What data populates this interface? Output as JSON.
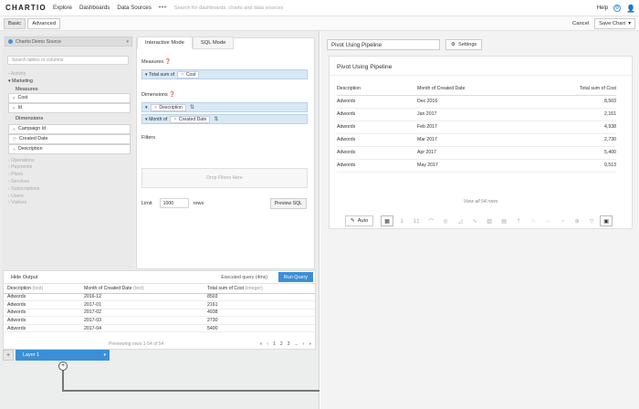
{
  "topbar": {
    "logo": "CHARTIO",
    "nav": [
      "Explore",
      "Dashboards",
      "Data Sources"
    ],
    "more": "•••",
    "search_placeholder": "Search for dashboards, charts and data sources",
    "help": "Help"
  },
  "subbar": {
    "tabs": [
      "Basic",
      "Advanced"
    ],
    "cancel": "Cancel",
    "save_chart": "Save Chart"
  },
  "schema": {
    "data_source": "Chartio Demo Source",
    "search_placeholder": "Search tables or columns",
    "tables_before": [
      "Activity"
    ],
    "active_table": "Marketing",
    "measures_label": "Measures",
    "measures": [
      "Cost",
      "Id"
    ],
    "dimensions_label": "Dimensions",
    "dimensions": [
      "Campaign Id",
      "Created Date",
      "Description"
    ],
    "tables_after": [
      "Operations",
      "Payments",
      "Plans",
      "Services",
      "Subscriptions",
      "Users",
      "Visitors"
    ]
  },
  "builder": {
    "tabs": [
      "Interactive Mode",
      "SQL Mode"
    ],
    "measures_label": "Measures",
    "measure_prefix": "Total sum of",
    "measure_field": "Cost",
    "dimensions_label": "Dimensions",
    "dim1_field": "Description",
    "dim2_prefix": "Month of",
    "dim2_field": "Created Date",
    "filters_label": "Filters",
    "drop_filters": "Drop Filters Here",
    "limit_label": "Limit",
    "limit_value": "1000",
    "rows_label": "rows",
    "preview_sql": "Preview SQL"
  },
  "results": {
    "hide_output": "Hide Output",
    "executed": "Executed query (4ms)",
    "run_query": "Run Query",
    "columns": [
      {
        "name": "Description",
        "type": "(text)"
      },
      {
        "name": "Month of Created Date",
        "type": "(text)"
      },
      {
        "name": "Total sum of Cost",
        "type": "(integer)"
      }
    ],
    "rows": [
      [
        "Adwords",
        "2016-12",
        "8503"
      ],
      [
        "Adwords",
        "2017-01",
        "2161"
      ],
      [
        "Adwords",
        "2017-02",
        "4938"
      ],
      [
        "Adwords",
        "2017-03",
        "2730"
      ],
      [
        "Adwords",
        "2017-04",
        "5400"
      ]
    ],
    "preview_info": "Previewing rows 1-54 of 54",
    "pages": [
      "«",
      "‹",
      "1",
      "2",
      "3",
      "...",
      "›",
      "»"
    ]
  },
  "layers": {
    "add": "+",
    "layer_name": "Layer 1",
    "plus_node": "+"
  },
  "chart": {
    "title": "Pivot Using Pipeline",
    "settings": "Settings",
    "card_title": "Pivot Using Pipeline",
    "columns": [
      "Description",
      "Month of Created Date",
      "Total sum of Cost"
    ],
    "rows": [
      [
        "Adwords",
        "Dec 2016",
        "8,503"
      ],
      [
        "Adwords",
        "Jan 2017",
        "2,161"
      ],
      [
        "Adwords",
        "Feb 2017",
        "4,938"
      ],
      [
        "Adwords",
        "Mar 2017",
        "2,730"
      ],
      [
        "Adwords",
        "Apr 2017",
        "5,400"
      ],
      [
        "Adwords",
        "May 2017",
        "9,513"
      ]
    ],
    "view_all": "View all 54 rows",
    "auto": "Auto"
  },
  "colors": {
    "accent": "#3c8fd6",
    "pill": "#d9e8f5"
  }
}
